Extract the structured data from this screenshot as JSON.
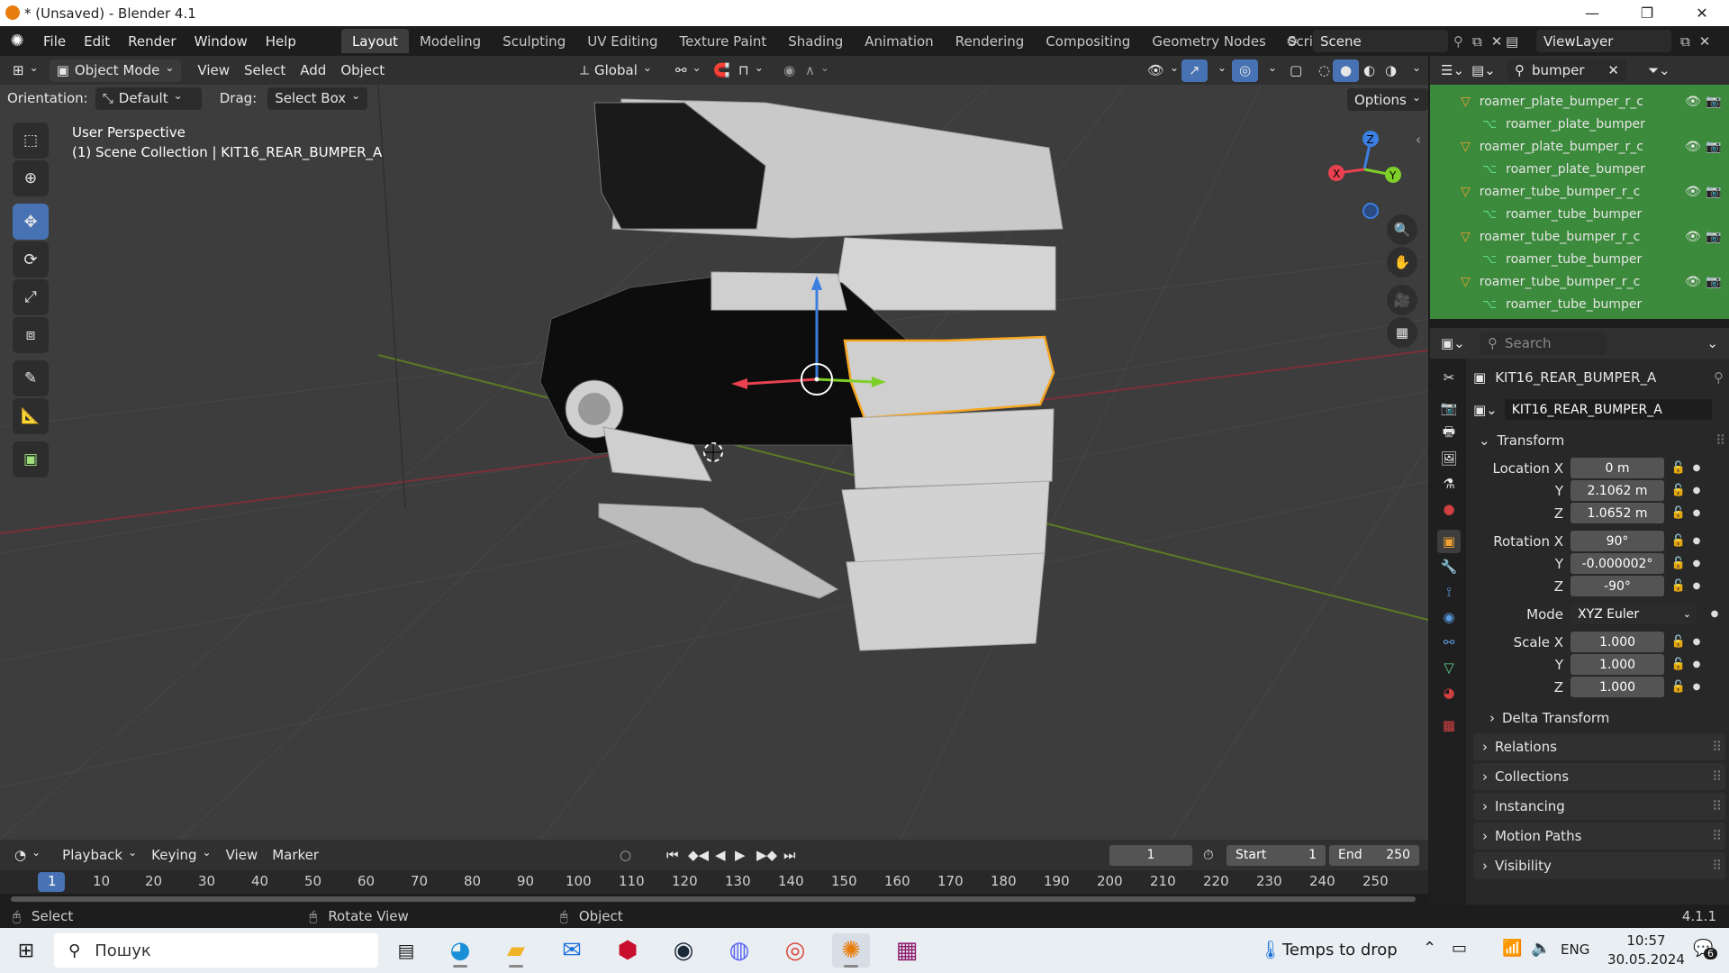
{
  "window": {
    "title": "* (Unsaved) - Blender 4.1",
    "minimize": "—",
    "restore": "❐",
    "close": "✕"
  },
  "menu": {
    "items": [
      "File",
      "Edit",
      "Render",
      "Window",
      "Help"
    ]
  },
  "workspaces": {
    "tabs": [
      "Layout",
      "Modeling",
      "Sculpting",
      "UV Editing",
      "Texture Paint",
      "Shading",
      "Animation",
      "Rendering",
      "Compositing",
      "Geometry Nodes",
      "Scripting"
    ],
    "active": "Layout",
    "add": "+"
  },
  "scene": {
    "name": "Scene"
  },
  "view_layer": {
    "name": "ViewLayer"
  },
  "viewport_header": {
    "mode": "Object Mode",
    "menus": [
      "View",
      "Select",
      "Add",
      "Object"
    ],
    "transform_orientation": "Global"
  },
  "tool_settings": {
    "orientation_label": "Orientation:",
    "orientation_value": "Default",
    "drag_label": "Drag:",
    "drag_value": "Select Box",
    "options": "Options"
  },
  "viewport_info": {
    "perspective": "User Perspective",
    "collection_line": "(1) Scene Collection | KIT16_REAR_BUMPER_A"
  },
  "gizmo": {
    "x": "X",
    "y": "Y",
    "z": "Z"
  },
  "outliner": {
    "search": "bumper",
    "rows": [
      {
        "label": "roamer_plate_bumper_r_c",
        "kind": "object"
      },
      {
        "label": "roamer_plate_bumper",
        "kind": "mesh"
      },
      {
        "label": "roamer_plate_bumper_r_c",
        "kind": "object"
      },
      {
        "label": "roamer_plate_bumper",
        "kind": "mesh"
      },
      {
        "label": "roamer_tube_bumper_r_c",
        "kind": "object"
      },
      {
        "label": "roamer_tube_bumper",
        "kind": "mesh"
      },
      {
        "label": "roamer_tube_bumper_r_c",
        "kind": "object"
      },
      {
        "label": "roamer_tube_bumper",
        "kind": "mesh"
      },
      {
        "label": "roamer_tube_bumper_r_c",
        "kind": "object"
      },
      {
        "label": "roamer_tube_bumper",
        "kind": "mesh"
      }
    ]
  },
  "properties": {
    "search_placeholder": "Search",
    "object_name": "KIT16_REAR_BUMPER_A",
    "object_field": "KIT16_REAR_BUMPER_A",
    "transform_title": "Transform",
    "location_label": "Location X",
    "location": {
      "x": "0 m",
      "y": "2.1062 m",
      "z": "1.0652 m"
    },
    "rotation_label": "Rotation X",
    "rotation": {
      "x": "90°",
      "y": "-0.000002°",
      "z": "-90°"
    },
    "mode_label": "Mode",
    "mode_value": "XYZ Euler",
    "scale_label": "Scale X",
    "scale": {
      "x": "1.000",
      "y": "1.000",
      "z": "1.000"
    },
    "axis_y": "Y",
    "axis_z": "Z",
    "sub_panels": [
      "Delta Transform"
    ],
    "panels": [
      "Relations",
      "Collections",
      "Instancing",
      "Motion Paths",
      "Visibility"
    ]
  },
  "timeline": {
    "menus": [
      "Playback",
      "Keying",
      "View",
      "Marker"
    ],
    "current_frame": "1",
    "start_label": "Start",
    "start": "1",
    "end_label": "End",
    "end": "250",
    "ruler_marks": [
      "1",
      "10",
      "20",
      "30",
      "40",
      "50",
      "60",
      "70",
      "80",
      "90",
      "100",
      "110",
      "120",
      "130",
      "140",
      "150",
      "160",
      "170",
      "180",
      "190",
      "200",
      "210",
      "220",
      "230",
      "240",
      "250"
    ]
  },
  "status": {
    "select": "Select",
    "rotate": "Rotate View",
    "object": "Object",
    "version": "4.1.1"
  },
  "taskbar": {
    "search_placeholder": "Пошук",
    "weather": "Temps to drop",
    "language": "ENG",
    "time": "10:57",
    "date": "30.05.2024",
    "notifications": "6"
  },
  "colors": {
    "accent": "#4772b3",
    "selection": "#f5a623",
    "outliner_bg": "#3c8a3c",
    "axis_x": "#e8414f",
    "axis_y": "#7fcf2a",
    "axis_z": "#3b7fe0"
  }
}
